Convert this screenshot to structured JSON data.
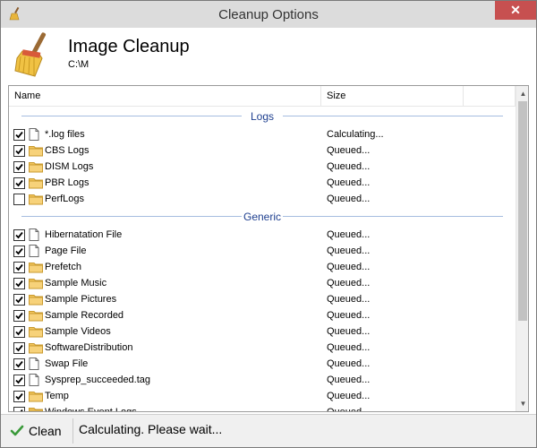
{
  "window": {
    "title": "Cleanup Options",
    "close_label": "✕"
  },
  "header": {
    "title": "Image Cleanup",
    "path": "C:\\M"
  },
  "columns": {
    "name": "Name",
    "size": "Size"
  },
  "groups": [
    {
      "label": "Logs",
      "items": [
        {
          "checked": true,
          "icon": "file-icon",
          "name": "*.log files",
          "size": "Calculating..."
        },
        {
          "checked": true,
          "icon": "folder-icon",
          "name": "CBS Logs",
          "size": "Queued..."
        },
        {
          "checked": true,
          "icon": "folder-icon",
          "name": "DISM Logs",
          "size": "Queued..."
        },
        {
          "checked": true,
          "icon": "folder-icon",
          "name": "PBR Logs",
          "size": "Queued..."
        },
        {
          "checked": false,
          "icon": "folder-icon",
          "name": "PerfLogs",
          "size": "Queued..."
        }
      ]
    },
    {
      "label": "Generic",
      "items": [
        {
          "checked": true,
          "icon": "file-icon",
          "name": "Hibernatation File",
          "size": "Queued..."
        },
        {
          "checked": true,
          "icon": "file-icon",
          "name": "Page File",
          "size": "Queued..."
        },
        {
          "checked": true,
          "icon": "folder-icon",
          "name": "Prefetch",
          "size": "Queued..."
        },
        {
          "checked": true,
          "icon": "folder-icon",
          "name": "Sample Music",
          "size": "Queued..."
        },
        {
          "checked": true,
          "icon": "folder-icon",
          "name": "Sample Pictures",
          "size": "Queued..."
        },
        {
          "checked": true,
          "icon": "folder-icon",
          "name": "Sample Recorded",
          "size": "Queued..."
        },
        {
          "checked": true,
          "icon": "folder-icon",
          "name": "Sample Videos",
          "size": "Queued..."
        },
        {
          "checked": true,
          "icon": "folder-icon",
          "name": "SoftwareDistribution",
          "size": "Queued..."
        },
        {
          "checked": true,
          "icon": "file-icon",
          "name": "Swap File",
          "size": "Queued..."
        },
        {
          "checked": true,
          "icon": "file-icon",
          "name": "Sysprep_succeeded.tag",
          "size": "Queued..."
        },
        {
          "checked": true,
          "icon": "folder-icon",
          "name": "Temp",
          "size": "Queued..."
        },
        {
          "checked": true,
          "icon": "folder-icon",
          "name": "Windows Event Logs",
          "size": "Queued..."
        }
      ]
    }
  ],
  "statusbar": {
    "clean_label": "Clean",
    "status_text": "Calculating. Please wait..."
  },
  "colors": {
    "titlebar": "#dcdcdc",
    "close": "#c75050",
    "group_label": "#1e3f8f",
    "folder": "#f2c55c",
    "check_green": "#3a9a3a"
  }
}
